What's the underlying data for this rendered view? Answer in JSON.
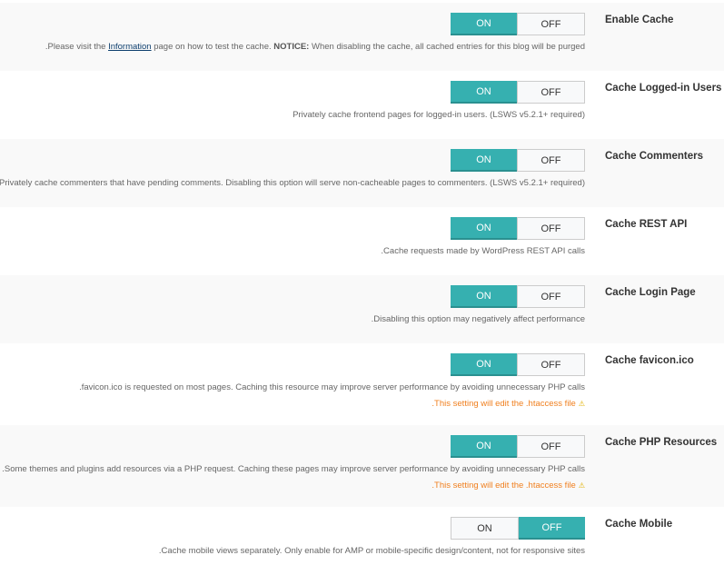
{
  "settings": [
    {
      "label": "Enable Cache",
      "on": "ON",
      "off": "OFF",
      "state": "on",
      "desc_pre": ".Please visit the ",
      "desc_link": "Information",
      "desc_mid": " page on how to test the cache. ",
      "desc_bold": "NOTICE:",
      "desc_post": " When disabling the cache, all cached entries for this blog will be purged"
    },
    {
      "label": "Cache Logged-in Users",
      "on": "ON",
      "off": "OFF",
      "state": "on",
      "desc": "Privately cache frontend pages for logged-in users. (LSWS v5.2.1+ required)"
    },
    {
      "label": "Cache Commenters",
      "on": "ON",
      "off": "OFF",
      "state": "on",
      "desc": "Privately cache commenters that have pending comments. Disabling this option will serve non-cacheable pages to commenters. (LSWS v5.2.1+ required)"
    },
    {
      "label": "Cache REST API",
      "on": "ON",
      "off": "OFF",
      "state": "on",
      "desc": ".Cache requests made by WordPress REST API calls"
    },
    {
      "label": "Cache Login Page",
      "on": "ON",
      "off": "OFF",
      "state": "on",
      "desc": ".Disabling this option may negatively affect performance"
    },
    {
      "label": "Cache favicon.ico",
      "on": "ON",
      "off": "OFF",
      "state": "on",
      "desc": ".favicon.ico is requested on most pages. Caching this resource may improve server performance by avoiding unnecessary PHP calls",
      "warning": ".This setting will edit the .htaccess file"
    },
    {
      "label": "Cache PHP Resources",
      "on": "ON",
      "off": "OFF",
      "state": "on",
      "desc": ".Some themes and plugins add resources via a PHP request. Caching these pages may improve server performance by avoiding unnecessary PHP calls",
      "warning": ".This setting will edit the .htaccess file"
    },
    {
      "label": "Cache Mobile",
      "on": "ON",
      "off": "OFF",
      "state": "off",
      "desc": ".Cache mobile views separately. Only enable for AMP or mobile-specific design/content, not for responsive sites"
    }
  ],
  "icons": {
    "warning": "warning-icon"
  },
  "colors": {
    "accent": "#36b0b0",
    "warning": "#f08020"
  }
}
